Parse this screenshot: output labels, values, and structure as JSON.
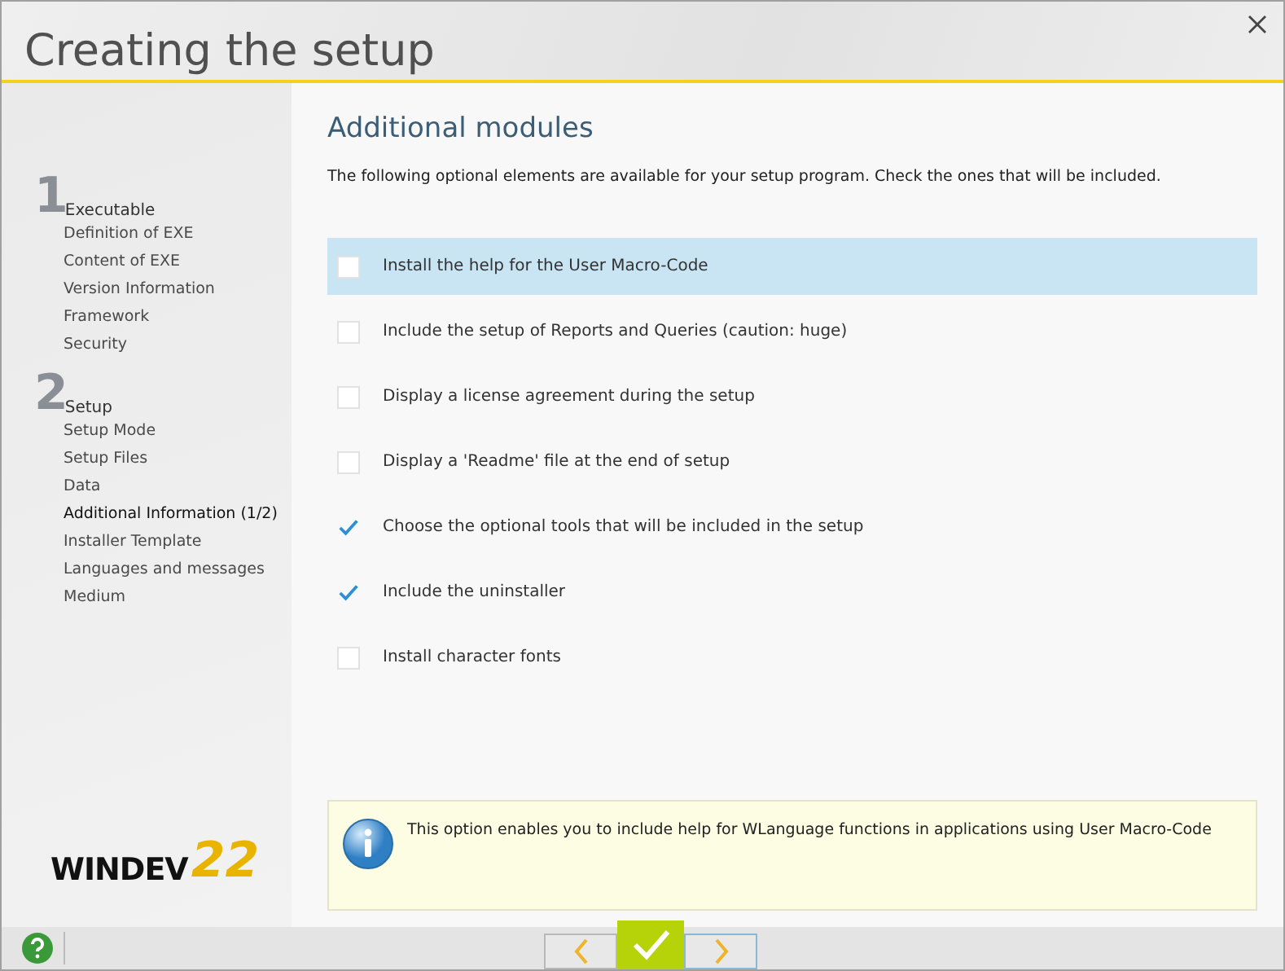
{
  "window": {
    "title": "Creating the setup"
  },
  "sidebar": {
    "sections": [
      {
        "number": "1",
        "title": "Executable",
        "items": [
          {
            "label": "Definition of EXE",
            "selected": false
          },
          {
            "label": "Content of EXE",
            "selected": false
          },
          {
            "label": "Version Information",
            "selected": false
          },
          {
            "label": "Framework",
            "selected": false
          },
          {
            "label": "Security",
            "selected": false
          }
        ]
      },
      {
        "number": "2",
        "title": "Setup",
        "items": [
          {
            "label": "Setup Mode",
            "selected": false
          },
          {
            "label": "Setup Files",
            "selected": false
          },
          {
            "label": "Data",
            "selected": false
          },
          {
            "label": "Additional Information (1/2)",
            "selected": true
          },
          {
            "label": "Installer Template",
            "selected": false
          },
          {
            "label": "Languages and messages",
            "selected": false
          },
          {
            "label": "Medium",
            "selected": false
          }
        ]
      }
    ],
    "logo": {
      "name": "WINDEV",
      "version": "22"
    }
  },
  "content": {
    "heading": "Additional modules",
    "description": "The following optional elements are available for your setup program. Check the ones that will be included.",
    "options": [
      {
        "label": "Install the help for the User Macro-Code",
        "checked": false,
        "selected": true
      },
      {
        "label": "Include the setup of Reports and Queries (caution: huge)",
        "checked": false,
        "selected": false
      },
      {
        "label": "Display a license agreement during the setup",
        "checked": false,
        "selected": false
      },
      {
        "label": "Display a 'Readme' file at the end of setup",
        "checked": false,
        "selected": false
      },
      {
        "label": "Choose the optional tools that will be included in the setup",
        "checked": true,
        "selected": false
      },
      {
        "label": "Include the uninstaller",
        "checked": true,
        "selected": false
      },
      {
        "label": "Install character fonts",
        "checked": false,
        "selected": false
      }
    ],
    "info": "This option enables you to include help for WLanguage functions in applications using User Macro-Code"
  }
}
